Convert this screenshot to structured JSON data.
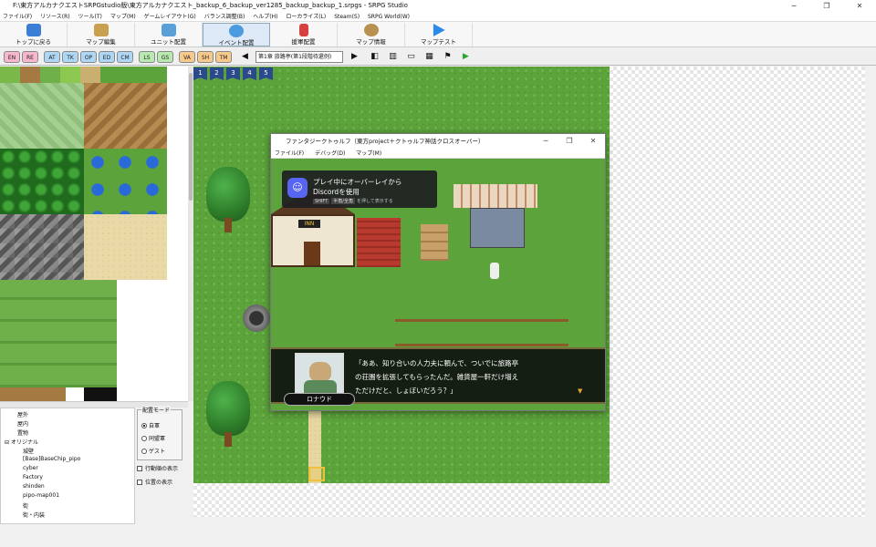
{
  "window": {
    "title": "F:\\東方アルカナクエストSRPGstudio版\\東方アルカナクエスト_backup_6_backup_ver1285_backup_backup_1.srpgs - SRPG Studio",
    "minimize": "─",
    "restore": "❐",
    "close": "✕"
  },
  "menu": [
    "ファイル(F)",
    "リソース(R)",
    "ツール(T)",
    "マップ(M)",
    "ゲームレイアウト(G)",
    "バランス調整(B)",
    "ヘルプ(H)",
    "ローカライズ(L)",
    "Steam(S)",
    "SRPG World(W)"
  ],
  "toolbar": [
    {
      "label": "トップに戻る",
      "color": "#3a7fd5"
    },
    {
      "label": "マップ編集",
      "color": "#c8a050"
    },
    {
      "label": "ユニット配置",
      "color": "#5aa0d8"
    },
    {
      "label": "イベント配置",
      "color": "#4a9be0"
    },
    {
      "label": "援軍配置",
      "color": "#d84040"
    },
    {
      "label": "マップ情報",
      "color": "#b89050"
    },
    {
      "label": "マップテスト",
      "color": "#2a8ae8"
    }
  ],
  "layers": [
    {
      "label": "EN",
      "kind": "pink"
    },
    {
      "label": "RE",
      "kind": "pink"
    },
    {
      "label": "AT",
      "kind": "blue"
    },
    {
      "label": "TK",
      "kind": "blue"
    },
    {
      "label": "OP",
      "kind": "blue"
    },
    {
      "label": "ED",
      "kind": "blue"
    },
    {
      "label": "CM",
      "kind": "blue"
    },
    {
      "label": "LS",
      "kind": "green"
    },
    {
      "label": "GS",
      "kind": "green"
    },
    {
      "label": "VA",
      "kind": "orange"
    },
    {
      "label": "SH",
      "kind": "orange"
    },
    {
      "label": "TM",
      "kind": "orange"
    }
  ],
  "map_selector": "第1章 旅路亭(第1段階待還例)",
  "tool_icons": [
    "◀",
    "▶",
    "◧",
    "▥",
    "▭",
    "▦",
    "⚑",
    "▶"
  ],
  "tree": [
    "屋外",
    "屋内",
    "置物",
    "オリジナル",
    "城壁",
    "[Base]BaseChip_pipo",
    "cyber",
    "Factory",
    "shinden",
    "pipo-map001",
    "街",
    "街・内装"
  ],
  "placement_mode": {
    "title": "配置モード",
    "options": [
      "自軍",
      "同盟軍",
      "ゲスト"
    ],
    "selected": 0
  },
  "checkboxes": [
    "行動順の表示",
    "位置の表示"
  ],
  "flags": [
    "1",
    "2",
    "3",
    "4",
    "5"
  ],
  "game": {
    "title": "ファンタジークトゥルフ（東方project＋クトゥルフ神話クロスオーバー）",
    "menu": [
      "ファイル(F)",
      "デバッグ(D)",
      "マップ(M)"
    ],
    "inn_sign": "INN",
    "discord": {
      "line1": "プレイ中にオーバーレイから",
      "line2": "Discordを使用",
      "key1": "SHIFT",
      "key2": "半角/全角",
      "hint": "を押して表示する"
    },
    "dialog": {
      "speaker": "ロナウド",
      "lines": [
        "「ああ、知り合いの人力夫に頼んで、ついでに旅路亭",
        "の荘園を拡張してもらったんだ。雑貨屋一軒だけ増え",
        "ただけだと、しょぼいだろう？」"
      ],
      "next": "▼"
    }
  }
}
